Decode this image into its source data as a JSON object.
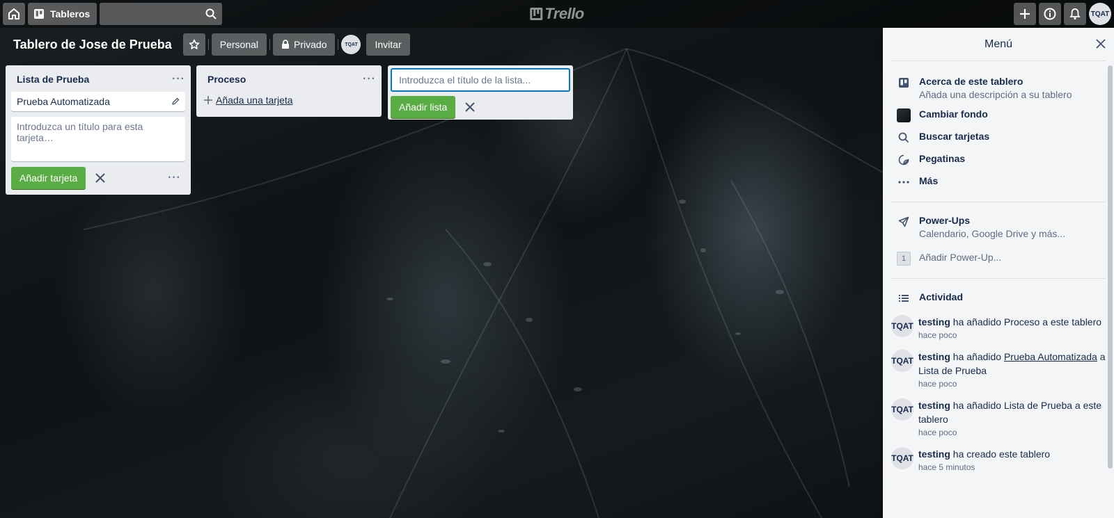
{
  "header": {
    "boards_label": "Tableros",
    "search_value": "",
    "logo_text": "Trello",
    "avatar_initials": "TQAT"
  },
  "board": {
    "title": "Tablero de Jose de Prueba",
    "personal_label": "Personal",
    "privacy_label": "Privado",
    "member_initials": "TQAT",
    "invite_label": "Invitar"
  },
  "lists": [
    {
      "title": "Lista de Prueba",
      "cards": [
        "Prueba Automatizada"
      ],
      "composer_placeholder": "Introduzca un título para esta tarjeta…",
      "add_button": "Añadir tarjeta"
    },
    {
      "title": "Proceso",
      "add_card_link": "Añada una tarjeta"
    }
  ],
  "add_list": {
    "placeholder": "Introduzca el título de la lista...",
    "button": "Añadir lista"
  },
  "sidebar": {
    "title": "Menú",
    "about_title": "Acerca de este tablero",
    "about_sub": "Añada una descripción a su tablero",
    "change_bg": "Cambiar fondo",
    "search_cards": "Buscar tarjetas",
    "stickers": "Pegatinas",
    "more": "Más",
    "powerups_title": "Power-Ups",
    "powerups_sub": "Calendario, Google Drive y más...",
    "add_powerup_count": "1",
    "add_powerup": "Añadir Power-Up...",
    "activity_title": "Actividad",
    "activity": [
      {
        "avatar": "TQAT",
        "user": "testing",
        "pre": " ha añadido Proceso a este tablero",
        "link": "",
        "post": "",
        "time": "hace poco"
      },
      {
        "avatar": "TQAT",
        "user": "testing",
        "pre": " ha añadido ",
        "link": "Prueba Automatizada",
        "post": " a Lista de Prueba",
        "time": "hace poco"
      },
      {
        "avatar": "TQAT",
        "user": "testing",
        "pre": " ha añadido Lista de Prueba a este tablero",
        "link": "",
        "post": "",
        "time": "hace poco"
      },
      {
        "avatar": "TQAT",
        "user": "testing",
        "pre": " ha creado este tablero",
        "link": "",
        "post": "",
        "time": "hace 5 minutos"
      }
    ]
  },
  "colors": {
    "accent_green": "#5aac44",
    "focus_blue": "#0079bf",
    "list_bg": "#ebecf0",
    "sidebar_bg": "#f4f5f7"
  }
}
